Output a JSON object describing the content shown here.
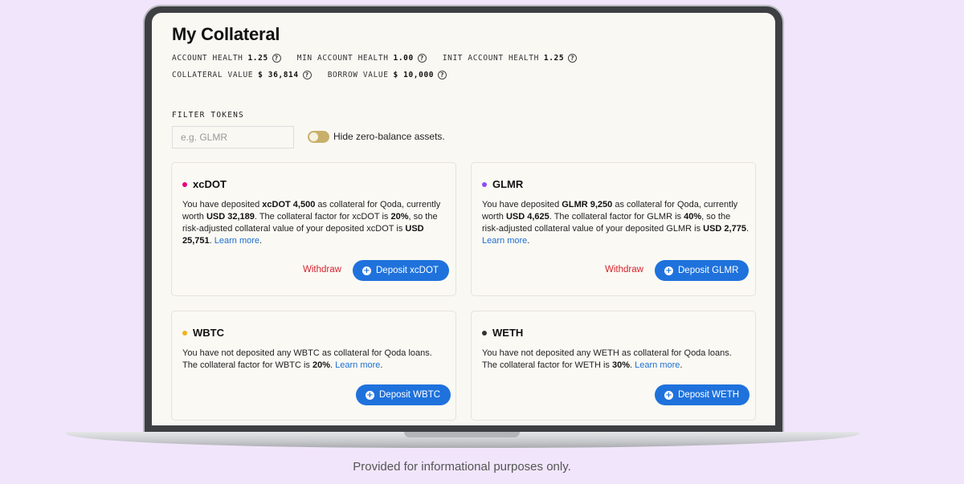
{
  "page": {
    "title": "My Collateral",
    "footer_note": "Provided for informational purposes only."
  },
  "stats": {
    "account_health": {
      "label": "ACCOUNT HEALTH",
      "value": "1.25"
    },
    "min_account_health": {
      "label": "MIN ACCOUNT HEALTH",
      "value": "1.00"
    },
    "init_account_health": {
      "label": "INIT ACCOUNT HEALTH",
      "value": "1.25"
    },
    "collateral_value": {
      "label": "COLLATERAL VALUE",
      "value": "$ 36,814"
    },
    "borrow_value": {
      "label": "BORROW VALUE",
      "value": "$ 10,000"
    }
  },
  "filter": {
    "label": "FILTER TOKENS",
    "placeholder": "e.g. GLMR",
    "toggle_label": "Hide zero-balance assets.",
    "toggle_on": false
  },
  "cards": [
    {
      "token": "xcDOT",
      "dot_color": "#e6007a",
      "deposited": true,
      "text": {
        "p1": "You have deposited ",
        "amount": "xcDOT 4,500",
        "p2": " as collateral for Qoda, currently worth ",
        "worth": "USD 32,189",
        "p3": ". The collateral factor for xcDOT is ",
        "factor": "20%",
        "p4": ", so the risk-adjusted collateral value of your deposited xcDOT is ",
        "adjusted": "USD 25,751",
        "p5": ". ",
        "learn": "Learn more",
        "p6": "."
      },
      "withdraw_label": "Withdraw",
      "deposit_label": "Deposit xcDOT"
    },
    {
      "token": "GLMR",
      "dot_color": "#8c4ef5",
      "deposited": true,
      "text": {
        "p1": "You have deposited ",
        "amount": "GLMR 9,250",
        "p2": " as collateral for Qoda, currently worth ",
        "worth": "USD 4,625",
        "p3": ". The collateral factor for GLMR is ",
        "factor": "40%",
        "p4": ", so the risk-adjusted collateral value of your deposited GLMR is ",
        "adjusted": "USD 2,775",
        "p5": ". ",
        "learn": "Learn more",
        "p6": "."
      },
      "withdraw_label": "Withdraw",
      "deposit_label": "Deposit GLMR"
    },
    {
      "token": "WBTC",
      "dot_color": "#f2b11b",
      "deposited": false,
      "text": {
        "p1": "You have not deposited any WBTC as collateral for Qoda loans. The collateral factor for WBTC is ",
        "factor": "20%",
        "p2": ". ",
        "learn": "Learn more",
        "p3": "."
      },
      "deposit_label": "Deposit WBTC"
    },
    {
      "token": "WETH",
      "dot_color": "#333333",
      "deposited": false,
      "text": {
        "p1": "You have not deposited any WETH as collateral for Qoda loans. The collateral factor for WETH is ",
        "factor": "30%",
        "p2": ". ",
        "learn": "Learn more",
        "p3": "."
      },
      "deposit_label": "Deposit WETH"
    }
  ]
}
